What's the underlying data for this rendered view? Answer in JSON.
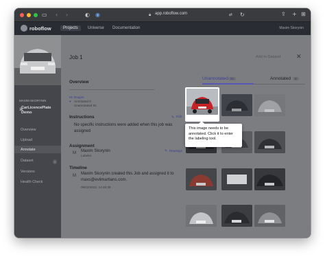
{
  "browser": {
    "url": "app.roboflow.com",
    "colors": {
      "close": "#ff5f57",
      "minimize": "#febc2e",
      "zoom": "#28c840"
    }
  },
  "nav": {
    "logo": "roboflow",
    "items": [
      "Projects",
      "Universe",
      "Documentation"
    ],
    "user": "Maxim Skorynin"
  },
  "sidebar": {
    "workspace": "MAXIM SKORYNIN",
    "project": "CarLicencePlate Demo",
    "items": [
      {
        "label": "Overview"
      },
      {
        "label": "Upload"
      },
      {
        "label": "Annotate"
      },
      {
        "label": "Dataset",
        "badge": "0"
      },
      {
        "label": "Versions"
      },
      {
        "label": "Health Check"
      }
    ]
  },
  "job": {
    "title": "Job 1",
    "add_to_dataset": "Add to Dataset",
    "overview_label": "Overview",
    "images_count": "91 Images",
    "annotated": "Annotated 0",
    "unannotated": "Unannotated 91",
    "instructions_label": "Instructions",
    "instructions_text": "No specific instructions were added when this job was assigned",
    "edit": "Edit",
    "assignment_label": "Assignment",
    "assignee": "Maxim Skorynin",
    "assignee_role": "Labeler",
    "reassign": "Reassign",
    "avatar_letter": "M",
    "timeline_label": "Timeline",
    "timeline_text": "Maxim Skorynin created this Job and assigned it to maxs@evilmartians.com.",
    "timeline_date": "06/02/2022, 14:46:39"
  },
  "tabs": [
    {
      "label": "Unannotated",
      "count": "91"
    },
    {
      "label": "Annotated",
      "count": "0"
    }
  ],
  "tooltip": "This image needs to be annotated. Click it to enter the labeling tool.",
  "accent": "#5558b5"
}
